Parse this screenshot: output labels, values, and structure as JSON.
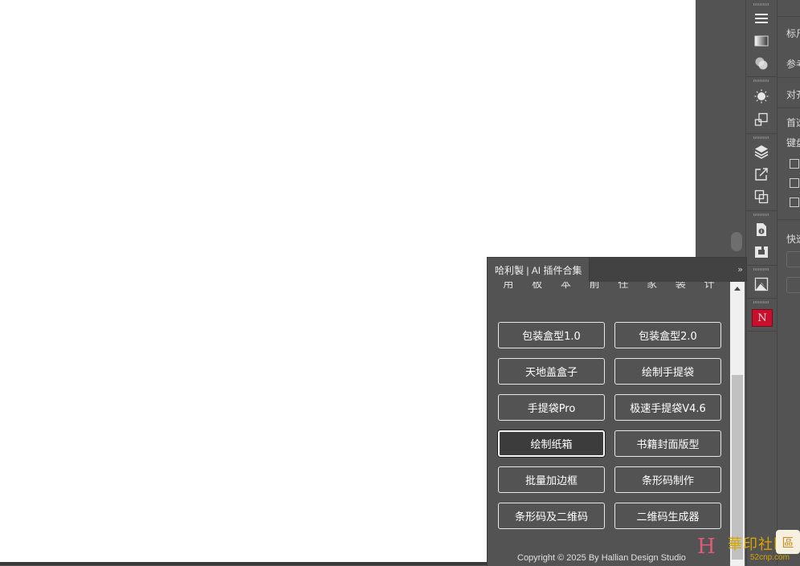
{
  "plugin_panel": {
    "tab_title": "哈利製 | AI 插件合集",
    "collapse_glyph": "››",
    "categories": [
      "用",
      "板",
      "本",
      "前",
      "任",
      "家",
      "装",
      "计"
    ],
    "buttons": [
      "包装盒型1.0",
      "包装盒型2.0",
      "天地盖盒子",
      "绘制手提袋",
      "手提袋Pro",
      "极速手提袋V4.6",
      "绘制纸箱",
      "书籍封面版型",
      "批量加边框",
      "条形码制作",
      "条形码及二维码",
      "二维码生成器"
    ],
    "active_button": "绘制纸箱",
    "footer": "Copyright © 2025 By Hallian Design Studio"
  },
  "right_panel": {
    "labels": [
      "标尺",
      "参考",
      "对齐",
      "首选",
      "键盘",
      "快速"
    ]
  },
  "tool_strip": {
    "icons": [
      "menu-icon",
      "gradient-icon",
      "transparency-icon",
      "sun-icon",
      "transform-icon",
      "layers-icon",
      "export-icon",
      "pathfinder-icon",
      "document-info-icon",
      "links-icon",
      "image-trace-icon",
      "plugin-icon"
    ],
    "plugin_glyph": "N"
  },
  "watermark": {
    "logo": "H",
    "text": "華印社區",
    "url": "52cnp.com",
    "badge": "區"
  },
  "colors": {
    "ui_bg": "#535353",
    "canvas_bg": "#ffffff",
    "plugin_icon_red": "#c8102e",
    "watermark_gold": "#d9a400"
  }
}
